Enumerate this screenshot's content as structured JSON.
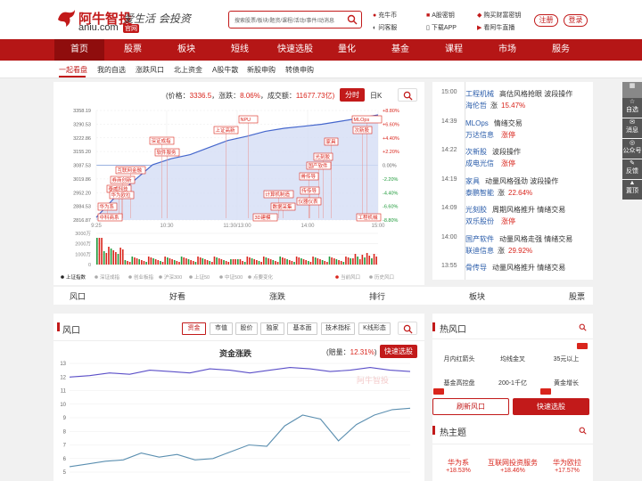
{
  "header": {
    "logo_cn": "阿牛智投",
    "logo_en": "aniu.com",
    "logo_badge": "官网",
    "slogan": "爱生活 会投资",
    "search_placeholder": "搜索股票/板块/题资/课程/活动/事件/动消息",
    "links": [
      "充牛币",
      "A股密钥",
      "购买财富密钥",
      "问客服",
      "下载APP",
      "看阿牛直播"
    ],
    "register": "注册",
    "login": "登录"
  },
  "nav": {
    "items": [
      "首页",
      "股票",
      "板块",
      "短线",
      "快速选股",
      "量化",
      "基金",
      "课程",
      "市场",
      "服务"
    ],
    "active": 0
  },
  "subnav": {
    "items": [
      "一起看盘",
      "我的自选",
      "涨跌风口",
      "北上资金",
      "A股牛散",
      "新股申购",
      "转债申购"
    ],
    "active": 0
  },
  "quote": {
    "price_label": "(价格：",
    "price": "3336.5",
    "change_label": "，涨跌：",
    "change": "8.06%",
    "volume_label": "，成交额：",
    "volume": "11677.73亿)",
    "tab_time": "分时",
    "tab_day": "日K"
  },
  "minute_chart": {
    "y_labels": [
      "3358.19",
      "3290.53",
      "3222.86",
      "3155.20",
      "3087.53",
      "3019.86",
      "2952.20",
      "2884.53",
      "2816.87"
    ],
    "pct_labels": [
      "+8.80%",
      "+6.60%",
      "+4.40%",
      "+2.20%",
      "0.00%",
      "-2.20%",
      "-4.40%",
      "-6.60%",
      "-8.80%"
    ],
    "x_labels": [
      "9:25",
      "10:30",
      "11:30/13:00",
      "14:00",
      "15:00"
    ],
    "vol_labels": [
      "3000万",
      "2000万",
      "1000万",
      "0"
    ],
    "events": [
      "NPU",
      "MLOps",
      "上证高新",
      "次新股",
      "软件服务",
      "家具",
      "光刻胶",
      "国产软件",
      "深证成指",
      "传传导",
      "骨传导",
      "仪器仪表",
      "计算机制造",
      "数据采集",
      "3D建模",
      "互联网金融",
      "泰威科技",
      "券商创新",
      "华为欧拉",
      "华为系",
      "中科商系",
      "工程机械"
    ],
    "legend": [
      "上证指数",
      "深证成指",
      "创业板指",
      "沪深300",
      "上证50",
      "中证500",
      "点要变化",
      "当前风口",
      "历史风口"
    ]
  },
  "fengkou_tabs": [
    "风口",
    "好看",
    "涨跌",
    "排行",
    "板块",
    "股票"
  ],
  "timeline": [
    {
      "time": "15:00",
      "name": "工程机械",
      "desc": "高估风格抢眼 波段操作",
      "stock": "海伦哲",
      "chg_label": "涨",
      "chg": "15.47%"
    },
    {
      "time": "14:39",
      "name": "MLOps",
      "desc": "情绪交易",
      "stock": "万达信息",
      "chg_label": "",
      "chg": "涨停"
    },
    {
      "time": "14:22",
      "name": "次新股",
      "desc": "波段操作",
      "stock": "成电光信",
      "chg_label": "",
      "chg": "涨停"
    },
    {
      "time": "14:19",
      "name": "家具",
      "desc": "动量风格强劲 波段操作",
      "stock": "泰鹏智能",
      "chg_label": "涨",
      "chg": "22.64%"
    },
    {
      "time": "14:09",
      "name": "光刻胶",
      "desc": "周期风格推升 情绪交易",
      "stock": "双乐股份",
      "chg_label": "",
      "chg": "涨停"
    },
    {
      "time": "14:00",
      "name": "国产软件",
      "desc": "动量风格走强 情绪交易",
      "stock": "联迪信息",
      "chg_label": "涨",
      "chg": "29.92%"
    },
    {
      "time": "13:55",
      "name": "骨传导",
      "desc": "动量风格推升 情绪交易",
      "stock": "",
      "chg_label": "",
      "chg": ""
    }
  ],
  "sidebar": [
    "",
    "自选",
    "消息",
    "公众号",
    "反馈",
    "置顶"
  ],
  "bottom": {
    "title": "风口",
    "tabs": [
      "资金",
      "市值",
      "股价",
      "独家",
      "基本面",
      "技术指标",
      "K线形态"
    ],
    "chart_title": "资金涨跌",
    "gain_label": "(赔量：",
    "gain": "12.31%",
    "gain_close": ")",
    "quick_btn": "快速选股",
    "y_labels": [
      "13",
      "12",
      "11",
      "10",
      "9",
      "8",
      "7",
      "6",
      "5"
    ],
    "watermark": "阿牛智投"
  },
  "hot_fengkou": {
    "title": "热风口",
    "items": [
      "月内红箭头",
      "均线金叉",
      "35元以上",
      "基金高控盘",
      "200-1千亿",
      "黄金增长"
    ],
    "refresh": "刷新风口",
    "select": "快速选股"
  },
  "hot_theme": {
    "title": "热主题",
    "items": [
      {
        "name": "华为系",
        "chg": "+18.53%"
      },
      {
        "name": "互联网投资服务",
        "chg": "+18.46%"
      },
      {
        "name": "华为欧拉",
        "chg": "+17.57%"
      }
    ]
  },
  "chart_data": [
    {
      "type": "line",
      "title": "",
      "series": [
        {
          "name": "上证指数",
          "values": [
            2830,
            2930,
            3010,
            3090,
            3120,
            3140,
            3175,
            3210,
            3230,
            3255,
            3270,
            3280,
            3290,
            3305,
            3320,
            3336
          ]
        }
      ],
      "x_labels": [
        "9:25",
        "10:30",
        "11:30/13:00",
        "14:00",
        "15:00"
      ],
      "ylim": [
        2816.87,
        3358.19
      ]
    },
    {
      "type": "line",
      "title": "资金涨跌",
      "series": [
        {
          "name": "",
          "values": [
            12.0,
            12.1,
            12.3,
            12.2,
            12.5,
            12.4,
            12.3,
            12.6,
            12.5,
            12.3,
            12.5,
            12.7,
            12.6,
            12.4,
            12.5,
            12.7,
            12.5,
            12.4
          ]
        },
        {
          "name": "",
          "values": [
            5.4,
            5.6,
            5.8,
            5.9,
            6.4,
            6.1,
            6.3,
            5.9,
            6.0,
            6.5,
            7.0,
            6.9,
            8.4,
            9.2,
            8.9,
            7.3,
            8.5,
            9.2,
            9.6,
            9.7
          ]
        }
      ],
      "ylim": [
        5,
        13
      ]
    }
  ],
  "colors": {
    "brand": "#b51616",
    "accent": "#c21a1a",
    "up": "#d9251c",
    "down": "#1f9a3a",
    "line": "#4466cc"
  }
}
